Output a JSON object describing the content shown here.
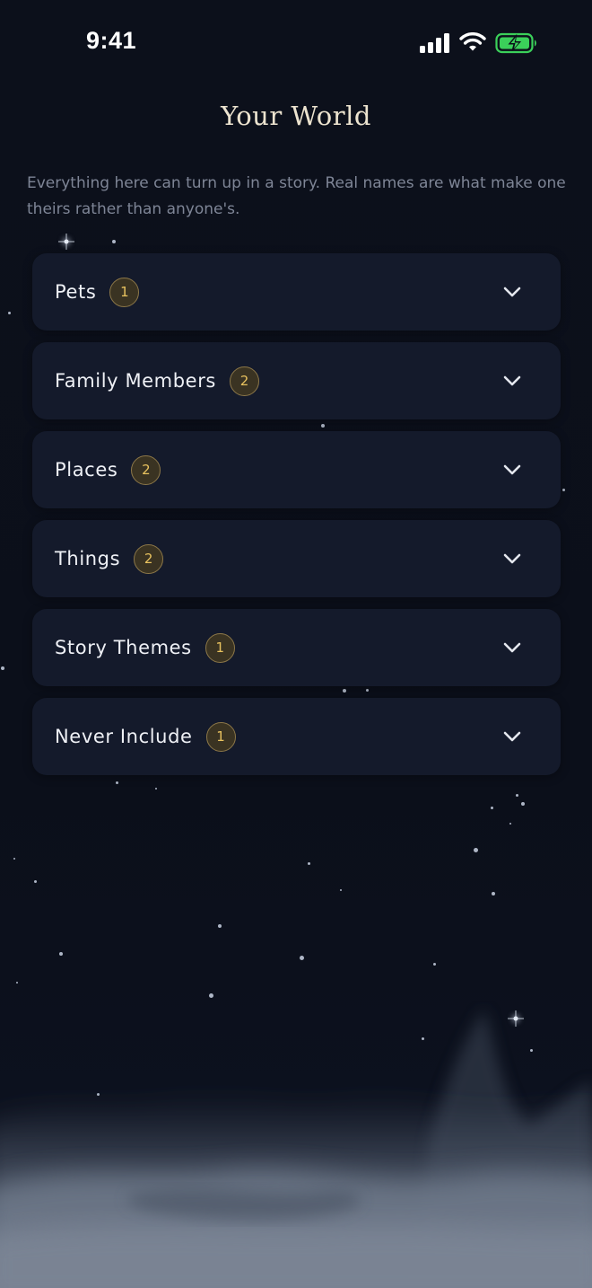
{
  "status_bar": {
    "time": "9:41"
  },
  "header": {
    "title": "Your World",
    "subtitle": "Everything here can turn up in a story. Real names are what make one theirs rather than anyone's."
  },
  "categories": [
    {
      "label": "Pets",
      "count": "1"
    },
    {
      "label": "Family Members",
      "count": "2"
    },
    {
      "label": "Places",
      "count": "2"
    },
    {
      "label": "Things",
      "count": "2"
    },
    {
      "label": "Story Themes",
      "count": "1"
    },
    {
      "label": "Never Include",
      "count": "1"
    }
  ],
  "colors": {
    "background": "#0b0f1a",
    "card": "#141a2b",
    "title": "#ece3cf",
    "badge_text": "#e8c25f",
    "badge_border": "#8c7748",
    "battery": "#3bd05a"
  }
}
